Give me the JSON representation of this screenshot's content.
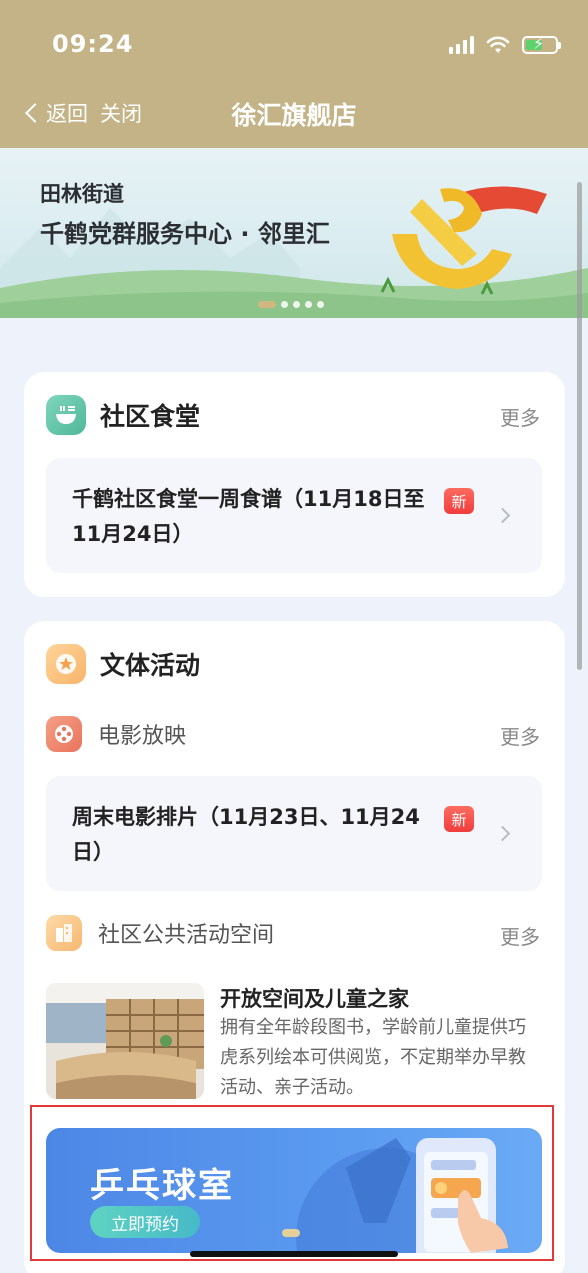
{
  "status_bar": {
    "time": "09:24"
  },
  "nav": {
    "back_label": "返回",
    "close_label": "关闭",
    "title": "徐汇旗舰店"
  },
  "banner": {
    "subtitle": "田林街道",
    "title": "千鹤党群服务中心 · 邻里汇",
    "slides": 5,
    "active_slide": 1
  },
  "canteen": {
    "title": "社区食堂",
    "more": "更多",
    "item": {
      "text": "千鹤社区食堂一周食谱（11月18日至11月24日）",
      "badge": "新"
    }
  },
  "activities": {
    "title": "文体活动",
    "movie": {
      "title": "电影放映",
      "more": "更多",
      "item": {
        "text": "周末电影排片（11月23日、11月24日）",
        "badge": "新"
      }
    },
    "space": {
      "title": "社区公共活动空间",
      "more": "更多",
      "item_title": "开放空间及儿童之家",
      "item_desc": "拥有全年龄段图书，学龄前儿童提供巧虎系列绘本可供阅览，不定期举办早教活动、亲子活动。"
    },
    "pingpong": {
      "title": "乒乓球室",
      "button": "立即预约"
    }
  },
  "colors": {
    "nav_bg": "#c3b386",
    "badge_red": "#ef3d3d",
    "banner_blue": "#4d87e6",
    "highlight_frame": "#e03a3a"
  }
}
